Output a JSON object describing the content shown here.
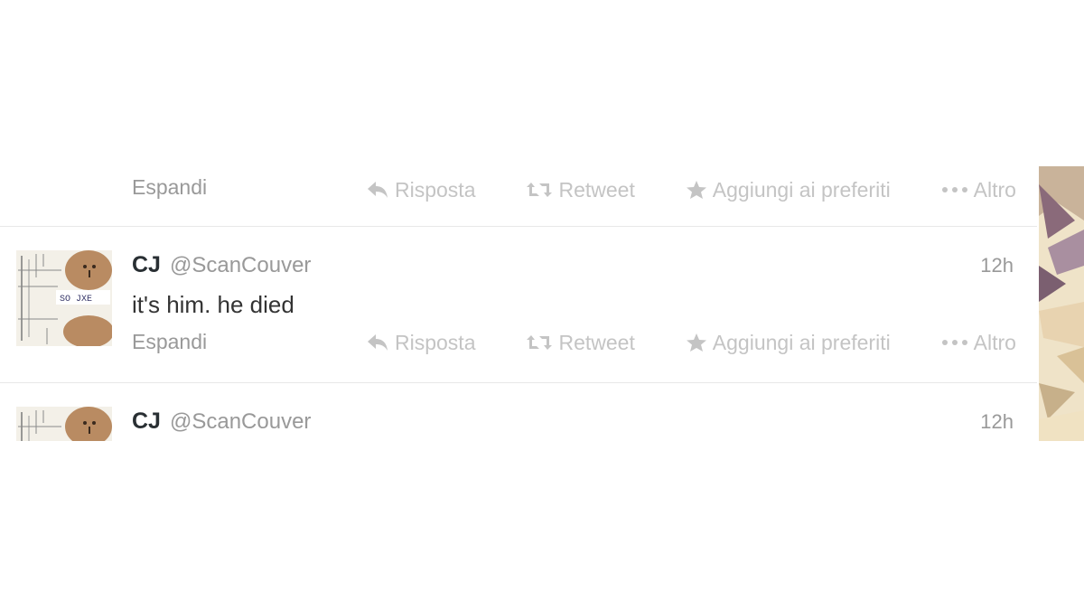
{
  "actions": {
    "expand": "Espandi",
    "reply": "Risposta",
    "retweet": "Retweet",
    "favorite": "Aggiungi ai preferiti",
    "more": "Altro"
  },
  "tweets": [
    {
      "fullname": "CJ",
      "username": "@ScanCouver",
      "time": "12h",
      "text": "it's him. he died"
    },
    {
      "fullname": "CJ",
      "username": "@ScanCouver",
      "time": "12h"
    }
  ],
  "avatar": {
    "badge_text": "SO JXE"
  },
  "icons": {
    "reply": "reply-arrow-icon",
    "retweet": "retweet-icon",
    "favorite": "star-icon",
    "more": "dots-icon"
  },
  "colors": {
    "name": "#292f33",
    "meta": "#999999",
    "action": "#c4c4c4",
    "divider": "#e8e8e8"
  }
}
